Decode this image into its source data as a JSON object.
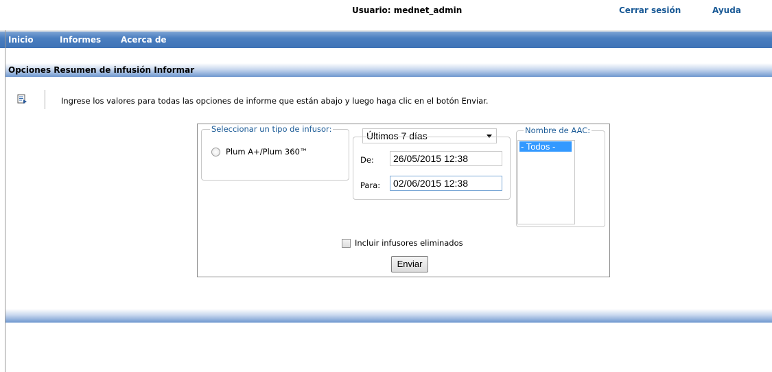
{
  "header": {
    "user_label": "Usuario: mednet_admin",
    "logout": "Cerrar sesión",
    "help": "Ayuda"
  },
  "nav": {
    "items": [
      "Inicio",
      "Informes",
      "Acerca de"
    ]
  },
  "section": {
    "title": "Opciones Resumen de infusión Informar"
  },
  "instructions": {
    "text": "Ingrese los valores para todas las opciones de informe que están abajo y luego haga clic en el botón Enviar.",
    "icon": "report-options-icon"
  },
  "form": {
    "infuser_legend": "Seleccionar un tipo de infusor:",
    "infuser_option": "Plum A+/Plum 360™",
    "period_selected": "Últimos 7 días",
    "from_label": "De:",
    "from_value": "26/05/2015 12:38",
    "to_label": "Para:",
    "to_value": "02/06/2015 12:38",
    "aac_legend": "Nombre de AAC:",
    "aac_options": [
      "- Todos -"
    ],
    "include_deleted_label": "Incluir infusores eliminados",
    "submit_label": "Enviar"
  },
  "colors": {
    "nav_bar": "#3f73b6",
    "link": "#1a5a96",
    "list_selection": "#3399ff"
  }
}
